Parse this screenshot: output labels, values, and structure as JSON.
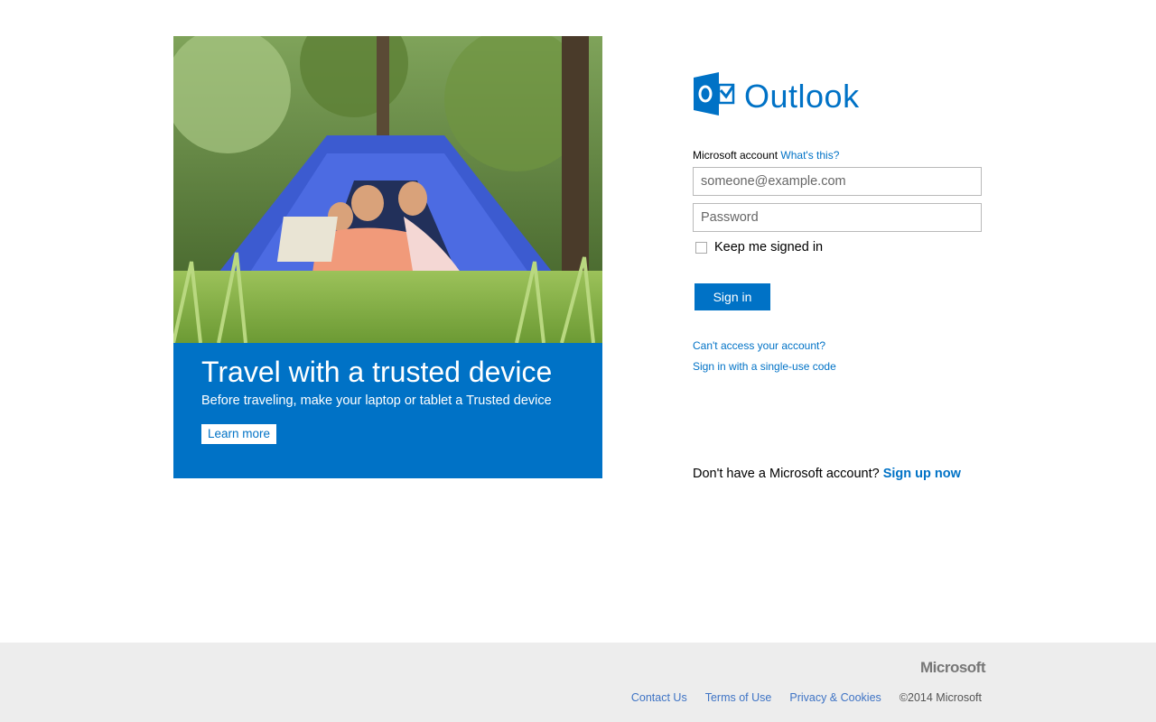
{
  "promo": {
    "title": "Travel with a trusted device",
    "subtitle": "Before traveling, make your laptop or tablet a Trusted device",
    "button_label": "Learn more"
  },
  "logo": {
    "text": "Outlook",
    "icon": "outlook-icon"
  },
  "form": {
    "account_label": "Microsoft account",
    "whats_this": "What's this?",
    "email_placeholder": "someone@example.com",
    "password_placeholder": "Password",
    "keep_signed_in": "Keep me signed in",
    "sign_in": "Sign in",
    "cant_access": "Can't access your account?",
    "single_use": "Sign in with a single-use code",
    "no_account": "Don't have a Microsoft account?",
    "sign_up": "Sign up now"
  },
  "footer": {
    "brand": "Microsoft",
    "links": [
      "Contact Us",
      "Terms of Use",
      "Privacy & Cookies"
    ],
    "copyright": "©2014 Microsoft"
  },
  "colors": {
    "accent": "#0072c6",
    "footer_bg": "#ededed"
  }
}
